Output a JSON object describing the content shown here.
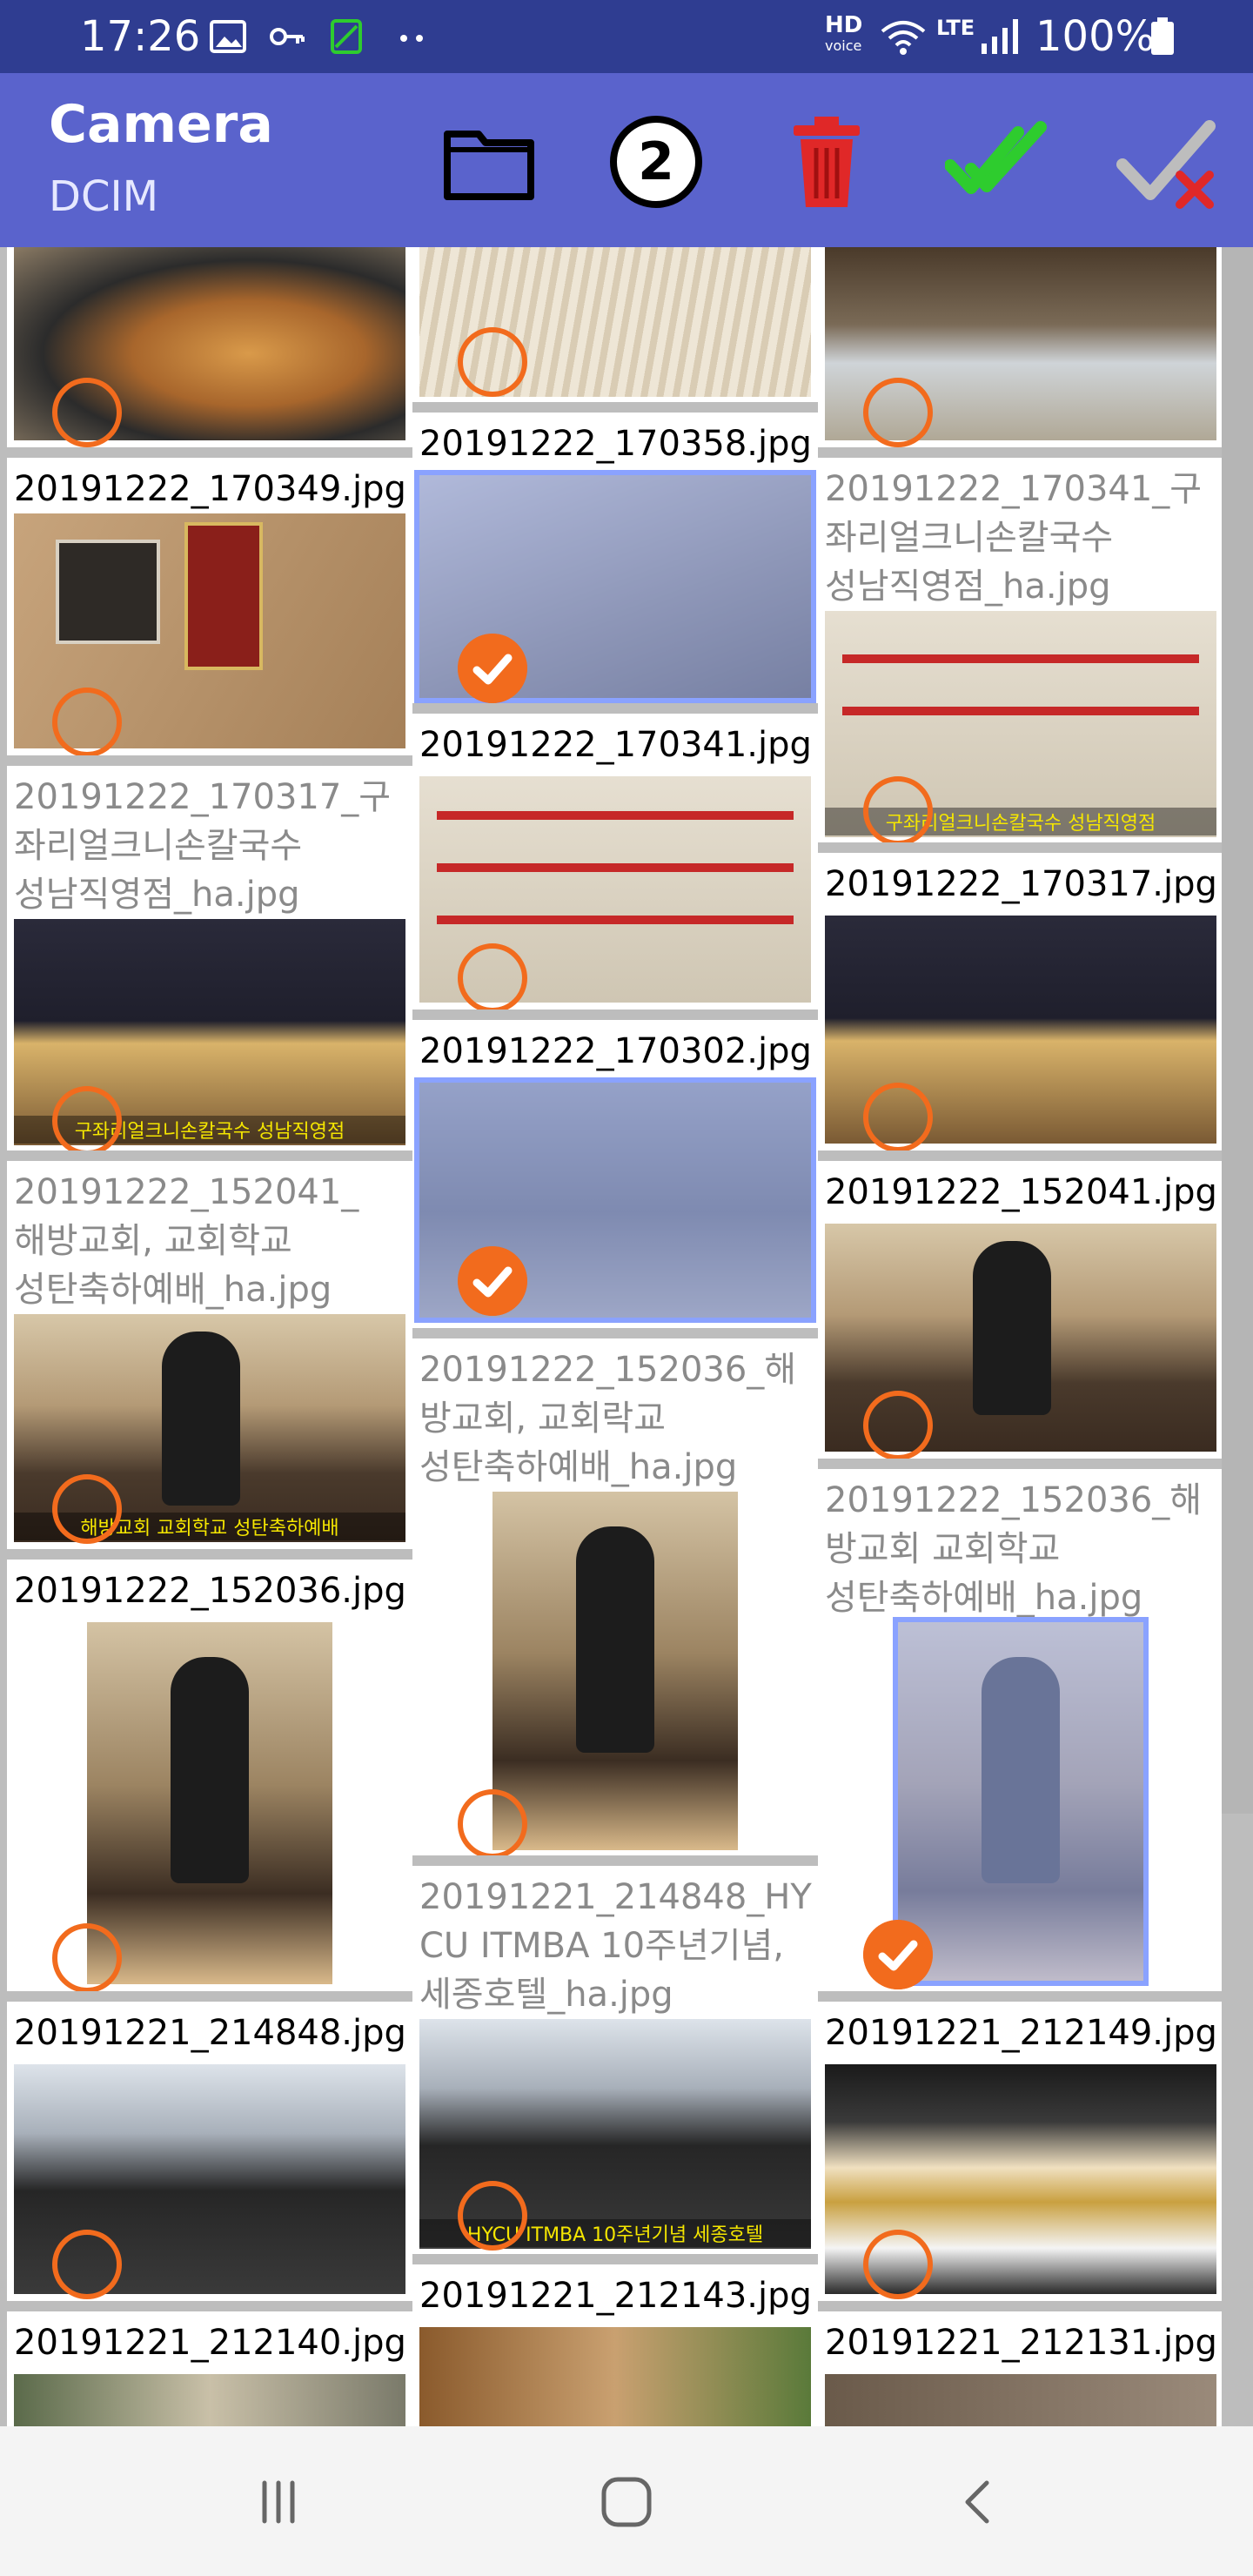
{
  "status": {
    "time": "17:26",
    "hd_label": "HD",
    "voice_label": "voice",
    "lte_label": "LTE",
    "battery": "100%"
  },
  "appbar": {
    "title": "Camera",
    "subtitle": "DCIM",
    "selected_count": "2"
  },
  "colors": {
    "status_bg": "#2f3d91",
    "appbar_bg": "#5a63cc",
    "accent_orange": "#f26b1d",
    "check_green": "#2ecc2e",
    "delete_red": "#e02828",
    "selection_blue": "#8aa2ff"
  },
  "icons": [
    "picture-icon",
    "key-icon",
    "screen-icon",
    "more-dots-icon",
    "wifi-icon",
    "signal-icon",
    "battery-icon",
    "folder-icon",
    "trash-icon",
    "double-check-icon",
    "uncheck-icon",
    "recents-icon",
    "home-icon",
    "back-icon"
  ],
  "grid": {
    "col1": [
      {
        "name": "",
        "selected": false
      },
      {
        "name": "20191222_170349.jpg",
        "selected": false
      },
      {
        "name": "20191222_170317_구\n좌리얼크니손칼국수\n성남직영점_ha.jpg",
        "selected": false,
        "faded": true,
        "overlay_text": "구좌리얼크니손칼국수 성남직영점"
      },
      {
        "name": "20191222_152041_\n해방교회, 교회학교\n성탄축하예배_ha.jpg",
        "selected": false,
        "faded": true,
        "overlay_text": "해방교회 교회학교 성탄축하예배"
      },
      {
        "name": "20191222_152036.jpg",
        "selected": false
      },
      {
        "name": "20191221_214848.jpg",
        "selected": false
      },
      {
        "name": "20191221_212140.jpg",
        "selected": false
      }
    ],
    "col2": [
      {
        "name": "",
        "selected": false
      },
      {
        "name": "20191222_170358.jpg",
        "selected": true
      },
      {
        "name": "20191222_170341.jpg",
        "selected": false
      },
      {
        "name": "20191222_170302.jpg",
        "selected": true
      },
      {
        "name": "20191222_152036_해\n방교회, 교회락교\n성탄축하예배_ha.jpg",
        "selected": false,
        "faded": true
      },
      {
        "name": "20191221_214848_HY\nCU ITMBA 10주년기념,\n세종호텔_ha.jpg",
        "selected": false,
        "faded": true,
        "overlay_text": "HYCU ITMBA 10주년기념 세종호텔"
      },
      {
        "name": "20191221_212143.jpg",
        "selected": false
      }
    ],
    "col3": [
      {
        "name": "",
        "selected": false
      },
      {
        "name": "20191222_170341_구\n좌리얼크니손칼국수\n성남직영점_ha.jpg",
        "selected": false,
        "faded": true,
        "overlay_text": "구좌리얼크니손칼국수 성남직영점"
      },
      {
        "name": "20191222_170317.jpg",
        "selected": false
      },
      {
        "name": "20191222_152041.jpg",
        "selected": false
      },
      {
        "name": "20191222_152036_해\n방교회 교회학교\n성탄축하예배_ha.jpg",
        "selected": true,
        "faded": true
      },
      {
        "name": "20191221_212149.jpg",
        "selected": false
      },
      {
        "name": "20191221_212131.jpg",
        "selected": false
      }
    ]
  }
}
